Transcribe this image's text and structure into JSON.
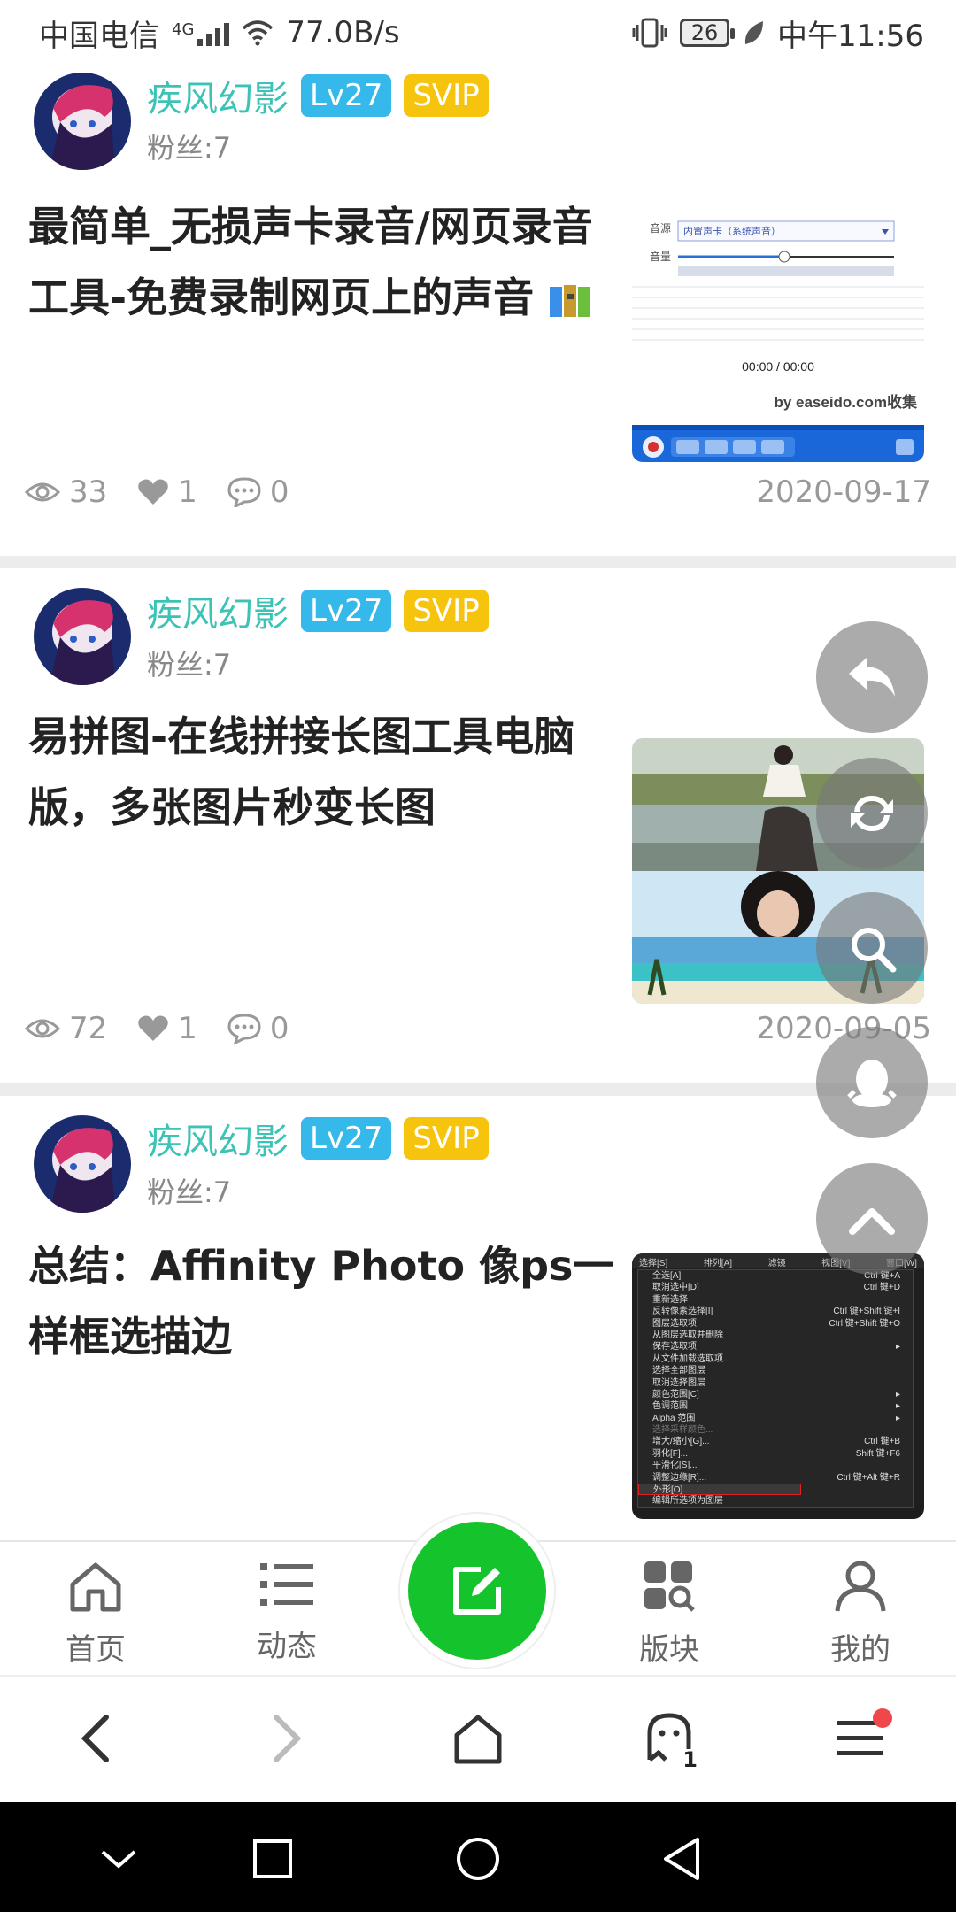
{
  "status_bar": {
    "carrier": "中国电信",
    "network": "4G",
    "speed": "77.0B/s",
    "battery": "26",
    "time": "中午11:56"
  },
  "posts": [
    {
      "author": "疾风幻影",
      "level": "Lv27",
      "vip": "SVIP",
      "fans": "粉丝:7",
      "title": "最简单_无损声卡录音/网页录音工具-免费录制网页上的声音",
      "title_icon": "zip-archive-icon",
      "views": "33",
      "likes": "1",
      "comments": "0",
      "date": "2020-09-17",
      "thumb": {
        "source_label": "音源",
        "source_value": "内置声卡（系统声音）",
        "volume_label": "音量",
        "time_display": "00:00 / 00:00",
        "credit": "by easeido.com收集"
      }
    },
    {
      "author": "疾风幻影",
      "level": "Lv27",
      "vip": "SVIP",
      "fans": "粉丝:7",
      "title": "易拼图-在线拼接长图工具电脑版，多张图片秒变长图",
      "views": "72",
      "likes": "1",
      "comments": "0",
      "date": "2020-09-05"
    },
    {
      "author": "疾风幻影",
      "level": "Lv27",
      "vip": "SVIP",
      "fans": "粉丝:7",
      "title": "总结：Affinity Photo 像ps一样框选描边",
      "menu_screenshot": {
        "menubar": [
          "选择[S]",
          "排列[A]",
          "滤镜",
          "视图[V]",
          "窗口[W]"
        ],
        "items": [
          {
            "label": "全选[A]",
            "shortcut": "Ctrl 键+A"
          },
          {
            "label": "取消选中[D]",
            "shortcut": "Ctrl 键+D"
          },
          {
            "label": "重新选择",
            "shortcut": ""
          },
          {
            "label": "反转像素选择[I]",
            "shortcut": "Ctrl 键+Shift 键+I"
          },
          {
            "label": "图层选取项",
            "shortcut": "Ctrl 键+Shift 键+O"
          },
          {
            "label": "从图层选取并删除",
            "shortcut": ""
          },
          {
            "label": "保存选取项",
            "shortcut": "▸"
          },
          {
            "label": "从文件加载选取项...",
            "shortcut": ""
          },
          {
            "label": "选择全部图层",
            "shortcut": ""
          },
          {
            "label": "取消选择图层",
            "shortcut": ""
          },
          {
            "label": "颜色范围[C]",
            "shortcut": "▸"
          },
          {
            "label": "色调范围",
            "shortcut": "▸"
          },
          {
            "label": "Alpha 范围",
            "shortcut": "▸"
          },
          {
            "label": "选择采样颜色...",
            "shortcut": ""
          },
          {
            "label": "增大/缩小[G]...",
            "shortcut": "Ctrl 键+B"
          },
          {
            "label": "羽化[F]...",
            "shortcut": "Shift 键+F6"
          },
          {
            "label": "平滑化[S]...",
            "shortcut": ""
          },
          {
            "label": "调整边缘[R]...",
            "shortcut": "Ctrl 键+Alt 键+R"
          },
          {
            "label": "外形[O]...",
            "shortcut": ""
          },
          {
            "label": "编辑所选项为图层",
            "shortcut": ""
          }
        ]
      }
    }
  ],
  "fabs": [
    "reply-icon",
    "refresh-icon",
    "search-icon",
    "qq-icon",
    "scroll-top-icon"
  ],
  "bottom_nav": {
    "home": "首页",
    "activity": "动态",
    "boards": "版块",
    "me": "我的"
  },
  "browser_bar": {
    "tab_count": "1"
  },
  "colors": {
    "author": "#3cc3b5",
    "level_badge": "#35b8ea",
    "svip_badge": "#f6c40c",
    "compose": "#15c42d",
    "notification_dot": "#f0474b"
  }
}
